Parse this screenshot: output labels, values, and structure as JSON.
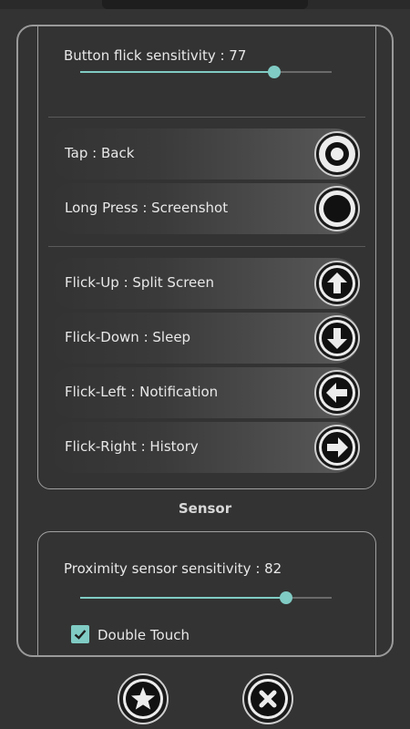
{
  "buttons_panel": {
    "flick_sensitivity_label": "Button flick sensitivity : 77",
    "flick_sensitivity_value": 77,
    "actions": [
      {
        "label": "Tap : Back",
        "icon": "ring-dot-icon"
      },
      {
        "label": "Long Press : Screenshot",
        "icon": "filled-circle-icon"
      },
      {
        "label": "Flick-Up : Split Screen",
        "icon": "arrow-up-icon"
      },
      {
        "label": "Flick-Down : Sleep",
        "icon": "arrow-down-icon"
      },
      {
        "label": "Flick-Left : Notification",
        "icon": "arrow-left-icon"
      },
      {
        "label": "Flick-Right : History",
        "icon": "arrow-right-icon"
      }
    ]
  },
  "sensor_section": {
    "title": "Sensor",
    "proximity_label": "Proximity sensor sensitivity : 82",
    "proximity_value": 82,
    "double_touch_label": "Double Touch",
    "double_touch_checked": true
  },
  "footer": {
    "buttons": [
      {
        "icon": "star-icon"
      },
      {
        "icon": "close-icon"
      }
    ]
  },
  "colors": {
    "accent": "#80cbc4",
    "background": "#333333"
  }
}
